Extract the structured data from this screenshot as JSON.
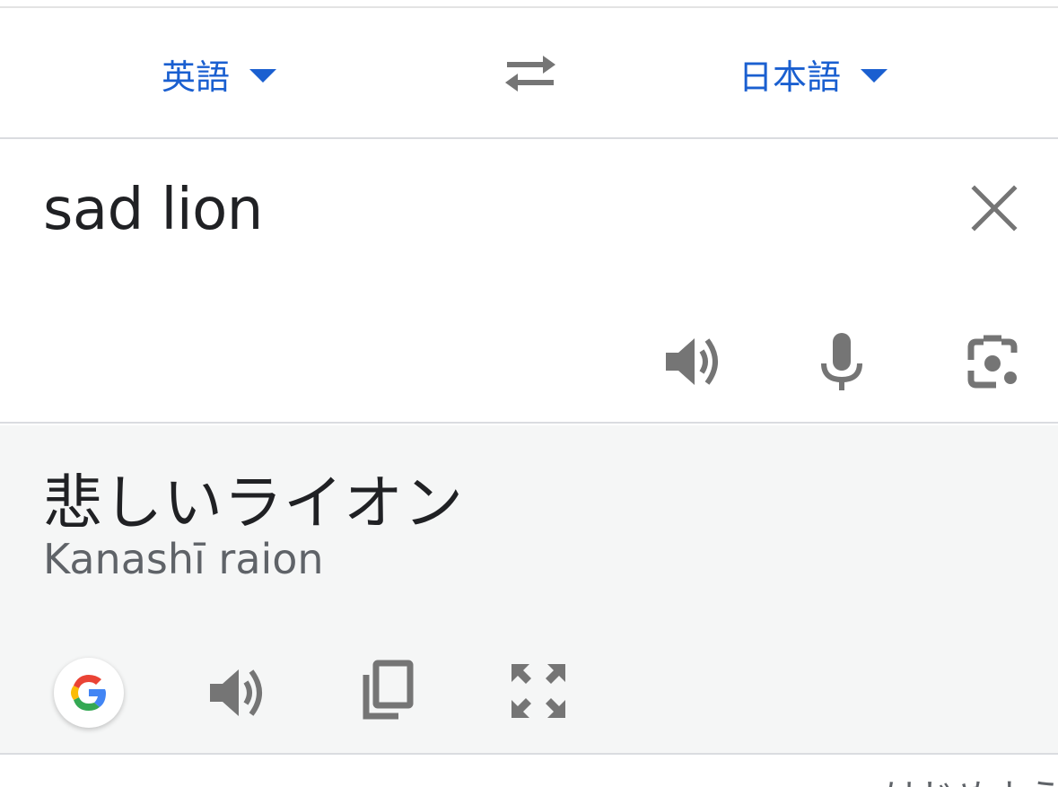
{
  "languages": {
    "source_label": "英語",
    "target_label": "日本語"
  },
  "input": {
    "text": "sad lion"
  },
  "output": {
    "translation": "悲しいライオン",
    "romanization": "Kanashī raion"
  },
  "bottom": {
    "partial_label": "はじめよう"
  },
  "icons": {
    "swap": "swap-languages-icon",
    "clear": "close-icon",
    "listen_source": "speaker-icon",
    "voice_input": "microphone-icon",
    "camera_input": "camera-icon",
    "google": "google-logo-icon",
    "listen_translation": "speaker-icon",
    "copy": "copy-icon",
    "fullscreen": "fullscreen-icon"
  },
  "colors": {
    "accent": "#1a5fd0",
    "icon_gray": "#757575",
    "text_primary": "#202124",
    "text_secondary": "#5f6368",
    "output_bg": "#f5f6f6",
    "divider": "#dadce0"
  }
}
